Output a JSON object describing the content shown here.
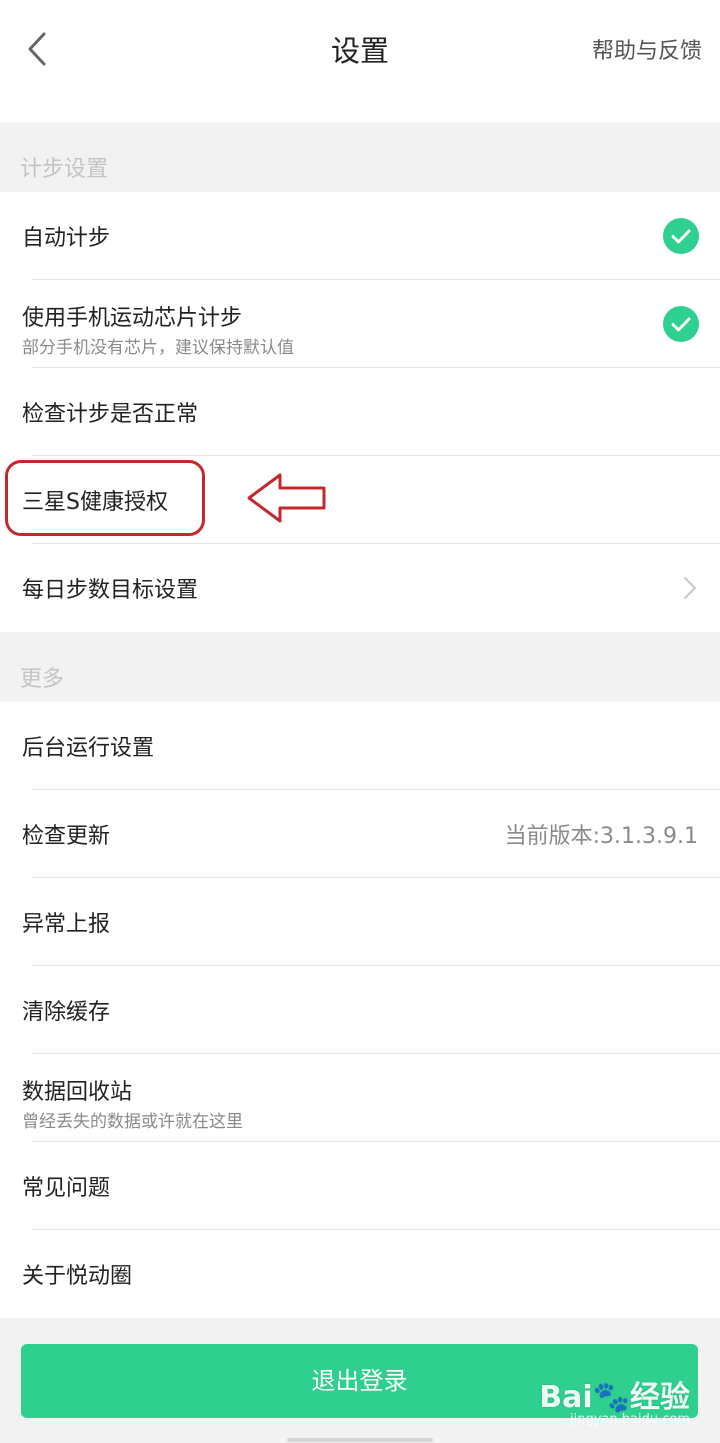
{
  "header": {
    "title": "设置",
    "help_label": "帮助与反馈"
  },
  "sections": {
    "step_label": "计步设置",
    "more_label": "更多"
  },
  "step_settings": {
    "auto_step": "自动计步",
    "chip_step": "使用手机运动芯片计步",
    "chip_step_sub": "部分手机没有芯片，建议保持默认值",
    "check_step": "检查计步是否正常",
    "samsung_auth": "三星S健康授权",
    "daily_goal": "每日步数目标设置"
  },
  "toggles": {
    "auto_step_checked": true,
    "chip_step_checked": true
  },
  "more": {
    "background_run": "后台运行设置",
    "check_update": "检查更新",
    "current_version": "当前版本:3.1.3.9.1",
    "report_error": "异常上报",
    "clear_cache": "清除缓存",
    "recycle_bin": "数据回收站",
    "recycle_bin_sub": "曾经丢失的数据或许就在这里",
    "faq": "常见问题",
    "about": "关于悦动圈"
  },
  "logout_label": "退出登录",
  "watermark": {
    "main": "Bai🐾经验",
    "sub": "jingyan.baidu.com"
  },
  "colors": {
    "accent": "#2fd08f",
    "annotation": "#c4282c"
  }
}
